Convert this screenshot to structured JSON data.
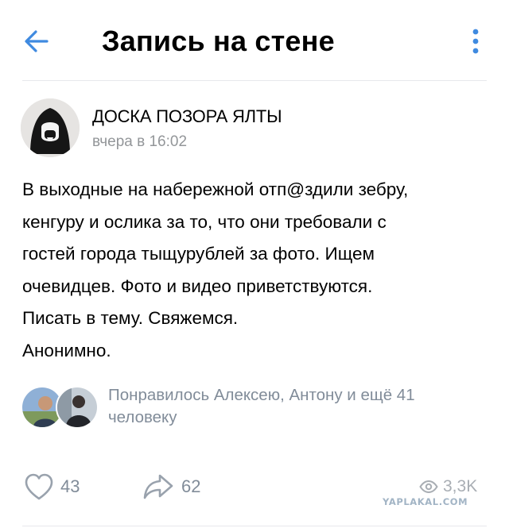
{
  "header": {
    "title": "Запись на стене",
    "back_icon": "arrow-left-icon",
    "more_icon": "more-vertical-icon",
    "accent_color": "#3f8ae0"
  },
  "post": {
    "author": "ДОСКА ПОЗОРА ЯЛТЫ",
    "time": "вчера в 16:02",
    "text_lines": [
      "В выходные на набережной отп@здили зебру,",
      "кенгуру и ослика за то, что они требовали с",
      "гостей города тыщурублей за фото. Ищем",
      "очевидцев. Фото и видео приветствуются.",
      "Писать в тему. Свяжемся.",
      "Анонимно."
    ]
  },
  "likes": {
    "text_lines": [
      "Понравилось Алексею, Антону и ещё 41",
      "человеку"
    ]
  },
  "actions": {
    "like_count": "43",
    "share_count": "62",
    "views_count": "3,3K"
  },
  "watermark": "YAPLAKAL.COM",
  "colors": {
    "secondary_text": "#818c99",
    "time_text": "#939699",
    "divider": "#e7e8ec"
  }
}
